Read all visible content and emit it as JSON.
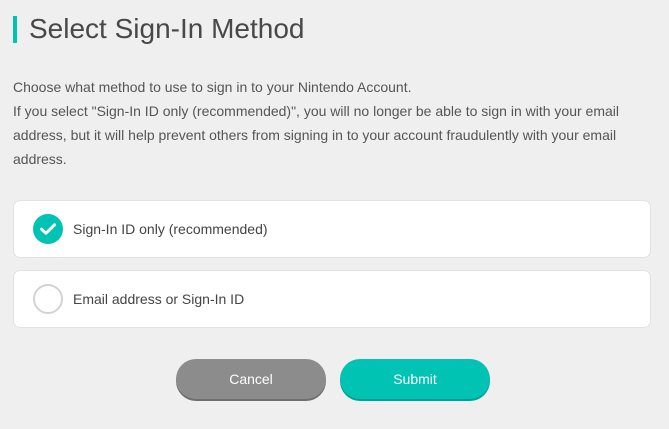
{
  "page": {
    "title": "Select Sign-In Method",
    "description_line1": "Choose what method to use to sign in to your Nintendo Account.",
    "description_line2": "If you select \"Sign-In ID only (recommended)\", you will no longer be able to sign in with your email address, but it will help prevent others from signing in to your account fraudulently with your email address."
  },
  "options": [
    {
      "label": "Sign-In ID only (recommended)",
      "selected": true,
      "icon": "check-icon"
    },
    {
      "label": "Email address or Sign-In ID",
      "selected": false,
      "icon": "radio-empty-icon"
    }
  ],
  "buttons": {
    "cancel_label": "Cancel",
    "submit_label": "Submit"
  },
  "colors": {
    "accent": "#00c3b3",
    "cancel": "#8c8c8c",
    "background": "#efefef"
  }
}
